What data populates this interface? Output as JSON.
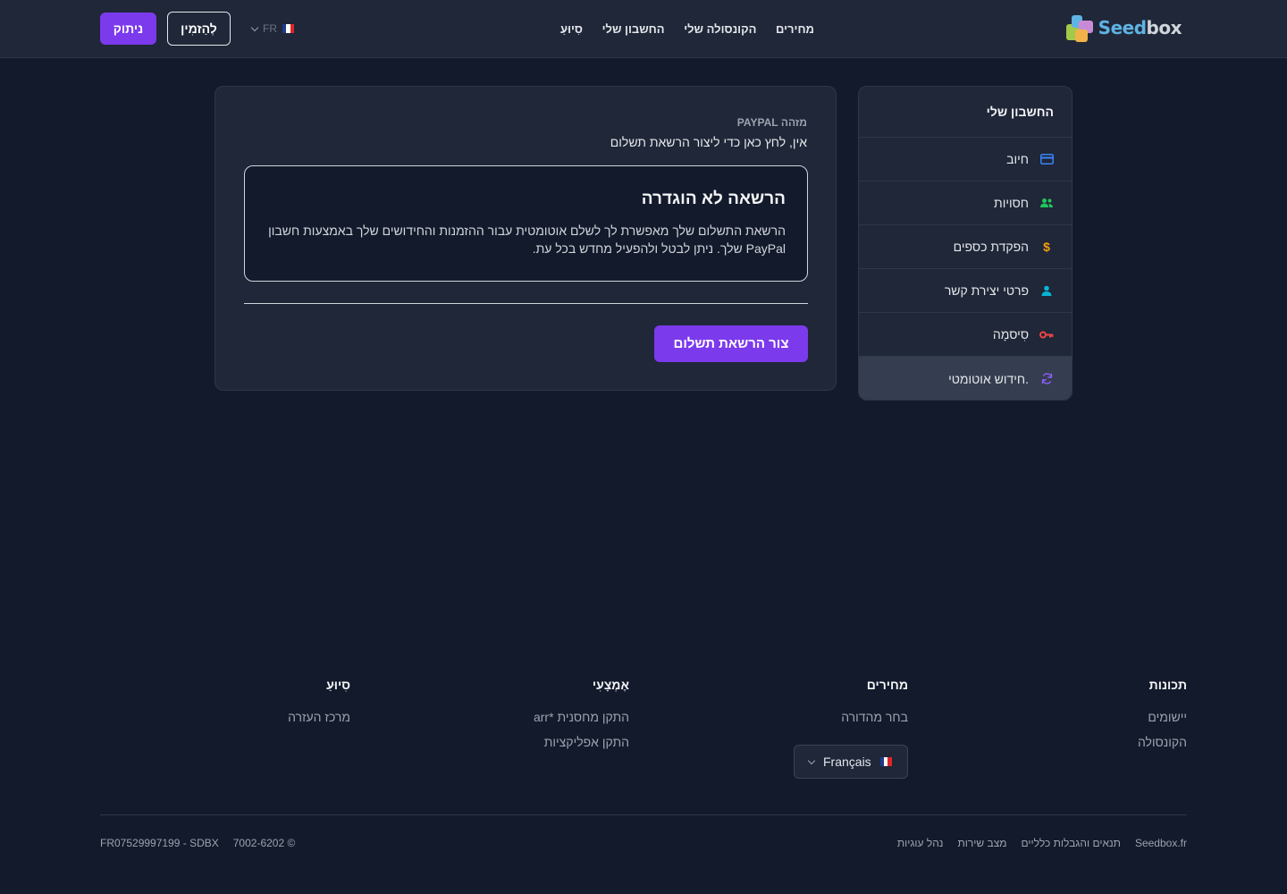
{
  "header": {
    "logo_text_a": "Seed",
    "logo_text_b": "box",
    "nav": [
      "מחירים",
      "הקונסולה שלי",
      "החשבון שלי",
      "סִיוּעַ"
    ],
    "lang_code": "FR",
    "order_label": "לְהַזמִין",
    "logout_label": "ניתוק"
  },
  "sidebar": {
    "title": "החשבון שלי",
    "items": [
      {
        "label": "חיוב",
        "icon": "credit-card-icon",
        "color": "#3b82f6"
      },
      {
        "label": "חסויות",
        "icon": "users-icon",
        "color": "#22c55e"
      },
      {
        "label": "הפקדת כספים",
        "icon": "dollar-icon",
        "color": "#f59e0b"
      },
      {
        "label": "פרטי יצירת קשר",
        "icon": "user-icon",
        "color": "#06b6d4"
      },
      {
        "label": "סִיסמָה",
        "icon": "key-icon",
        "color": "#ef4444"
      },
      {
        "label": "חידוש אוטומטי.",
        "icon": "refresh-icon",
        "color": "#8b5cf6"
      }
    ]
  },
  "main": {
    "label": "מזהה PAYPAL",
    "value": "אין, לחץ כאן כדי ליצור הרשאת תשלום",
    "alert_title": "הרשאה לא הוגדרה",
    "alert_text": "הרשאת התשלום שלך מאפשרת לך לשלם אוטומטית עבור ההזמנות והחידושים שלך באמצעות חשבון PayPal שלך. ניתן לבטל ולהפעיל מחדש בכל עת.",
    "create_button": "צור הרשאת תשלום"
  },
  "footer": {
    "columns": [
      {
        "title": "תכונות",
        "links": [
          "יישומים",
          "הקונסולה"
        ]
      },
      {
        "title": "מחירים",
        "links": [
          "בחר מהדורה"
        ]
      },
      {
        "title": "אֶמְצָעִי",
        "links": [
          "התקן מחסנית *arr",
          "התקן אפליקציות"
        ]
      },
      {
        "title": "סִיוּעַ",
        "links": [
          "מרכז העזרה"
        ]
      }
    ],
    "language": "Français",
    "bottom_links": [
      "Seedbox.fr",
      "תנאים והגבלות כלליים",
      "מצב שירות",
      "נהל עוגיות"
    ],
    "copyright": "© 2026-2007",
    "company": "FR07529997199 - SDBX"
  },
  "colors": {
    "accent": "#7c3aed",
    "background": "#131a2b",
    "surface": "#1f2738"
  }
}
